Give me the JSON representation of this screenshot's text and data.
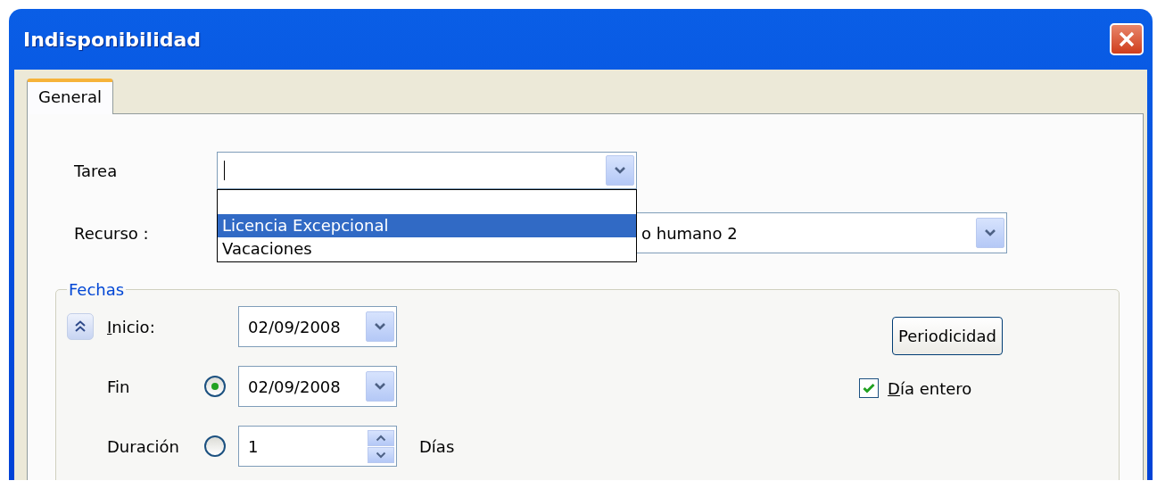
{
  "window": {
    "title": "Indisponibilidad"
  },
  "tabs": [
    {
      "label": "General",
      "selected": true
    }
  ],
  "tarea": {
    "label": "Tarea",
    "expanded": true,
    "options": [
      {
        "selected": false
      },
      {
        "label": "Licencia Excepcional",
        "selected": true
      },
      {
        "label": "Vacaciones",
        "selected": false
      }
    ]
  },
  "recurso": {
    "label": "Recurso :",
    "value": "o humano 2"
  },
  "fechas": {
    "title": "Fechas",
    "inicio": {
      "label": "Inicio:",
      "value": "02/09/2008"
    },
    "fin": {
      "label": "Fin",
      "selected": true,
      "value": "02/09/2008"
    },
    "duracion": {
      "label": "Duración",
      "selected": false,
      "value": "1",
      "unit": "Días"
    },
    "periodicidad_button": "Periodicidad",
    "dia_entero": {
      "label": "Día entero",
      "checked": true
    }
  }
}
